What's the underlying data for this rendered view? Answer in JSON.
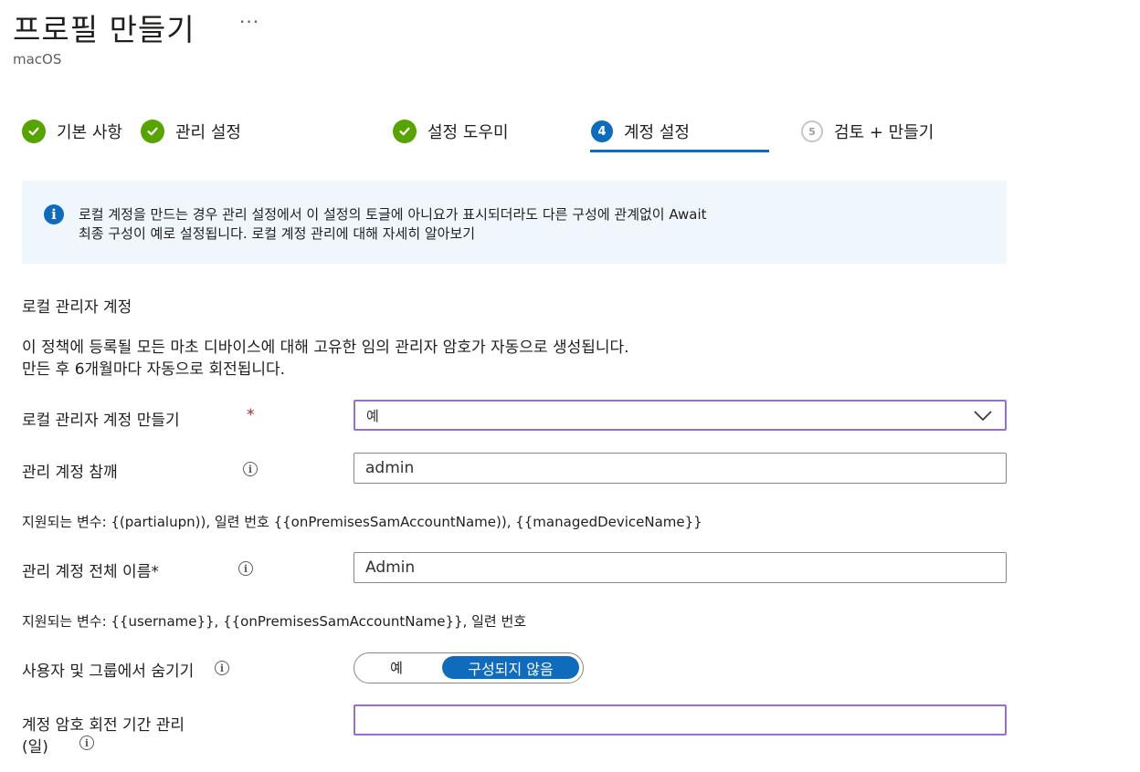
{
  "header": {
    "title": "프로필 만들기",
    "more": "···",
    "subtitle": "macOS"
  },
  "steps": [
    {
      "label": "기본 사항",
      "state": "done"
    },
    {
      "label": "관리 설정",
      "state": "done"
    },
    {
      "label": "설정 도우미",
      "state": "done"
    },
    {
      "number": "4",
      "label": "계정 설정",
      "state": "current"
    },
    {
      "number": "5",
      "label": "검토 + 만들기",
      "state": "todo"
    }
  ],
  "info": {
    "line1": "로컬 계정을 만드는 경우 관리 설정에서 이 설정의 토글에 아니요가 표시되더라도 다른 구성에 관계없이 Await",
    "line2": "최종 구성이 예로 설정됩니다. 로컬 계정 관리에 대해 자세히 알아보기"
  },
  "section": {
    "title": "로컬 관리자 계정",
    "desc_line1": "이 정책에 등록될 모든 마초 디바이스에 대해 고유한 임의 관리자 암호가 자동으로 생성됩니다.",
    "desc_line2": "만든 후 6개월마다 자동으로 회전됩니다."
  },
  "fields": {
    "create_admin": {
      "label": "로컬 관리자 계정 만들기",
      "required": "*",
      "value": "예"
    },
    "admin_short": {
      "label": "관리 계정 참깨",
      "value": "admin"
    },
    "admin_short_vars": "지원되는 변수: {(partialupn)), 일련 번호 {{onPremisesSamAccountName)), {{managedDeviceName}}",
    "admin_full": {
      "label": "관리 계정 전체 이름*",
      "value": "Admin"
    },
    "admin_full_vars": "지원되는 변수: {{username}},  {{onPremisesSamAccountName}}, 일련 번호",
    "hide": {
      "label": "사용자 및 그룹에서 숨기기",
      "yes": "예",
      "no": "구성되지 않음"
    },
    "rotation": {
      "label_line1": "계정 암호 회전 기간 관리",
      "label_line2": "(일)",
      "value": ""
    }
  },
  "colors": {
    "accent": "#0f6cbd",
    "success": "#57a300",
    "focus": "#9b6ec7",
    "info_bg": "#eff6fc"
  },
  "icons": {
    "check": "check-icon",
    "info": "info-icon",
    "chevron": "chevron-down-icon"
  }
}
